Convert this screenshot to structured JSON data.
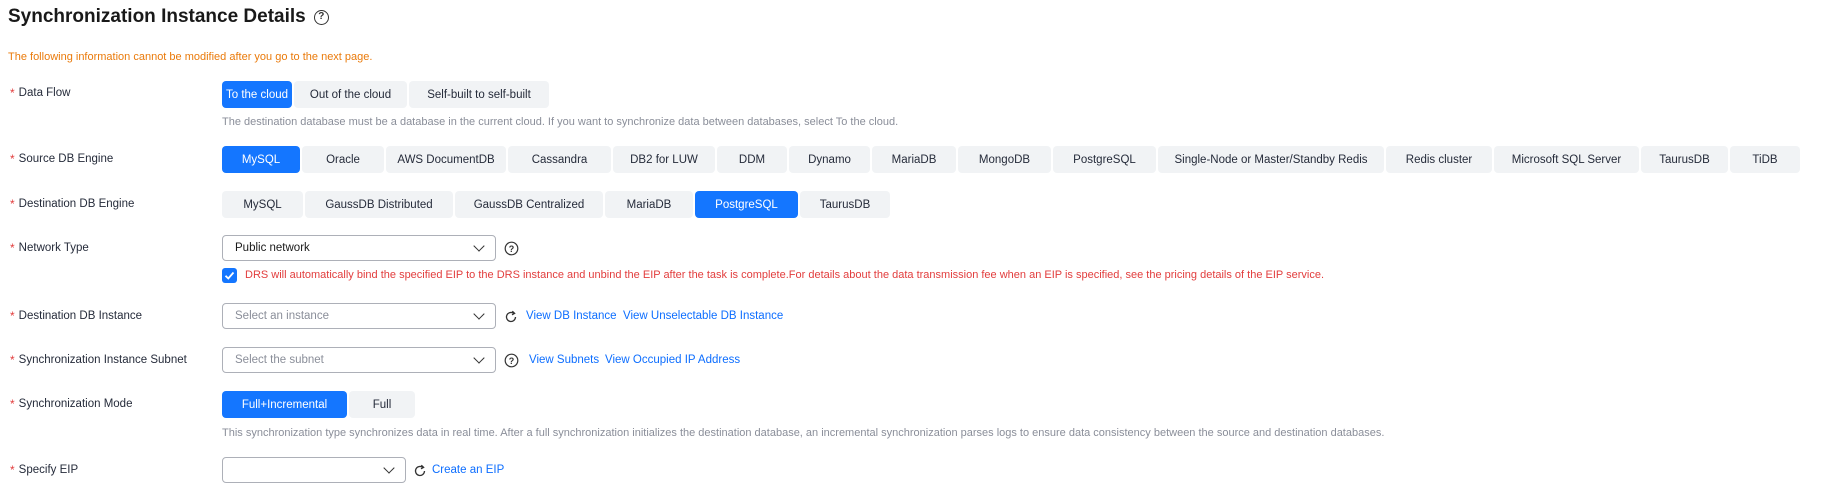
{
  "title": "Synchronization Instance Details",
  "warning": "The following information cannot be modified after you go to the next page.",
  "data_flow": {
    "label": "Data Flow",
    "options": [
      "To the cloud",
      "Out of the cloud",
      "Self-built to self-built"
    ],
    "selected": "To the cloud",
    "hint": "The destination database must be a database in the current cloud. If you want to synchronize data between databases, select To the cloud."
  },
  "source_engine": {
    "label": "Source DB Engine",
    "options": [
      "MySQL",
      "Oracle",
      "AWS DocumentDB",
      "Cassandra",
      "DB2 for LUW",
      "DDM",
      "Dynamo",
      "MariaDB",
      "MongoDB",
      "PostgreSQL",
      "Single-Node or Master/Standby Redis",
      "Redis cluster",
      "Microsoft SQL Server",
      "TaurusDB",
      "TiDB"
    ],
    "selected": "MySQL"
  },
  "dest_engine": {
    "label": "Destination DB Engine",
    "options": [
      "MySQL",
      "GaussDB Distributed",
      "GaussDB Centralized",
      "MariaDB",
      "PostgreSQL",
      "TaurusDB"
    ],
    "selected": "PostgreSQL"
  },
  "network_type": {
    "label": "Network Type",
    "value": "Public network",
    "checkbox_checked": true,
    "checkbox_text": "DRS will automatically bind the specified EIP to the DRS instance and unbind the EIP after the task is complete.For details about the data transmission fee when an EIP is specified, see the pricing details of the EIP service."
  },
  "dest_instance": {
    "label": "Destination DB Instance",
    "placeholder": "Select an instance",
    "link1": "View DB Instance",
    "link2": "View Unselectable DB Instance"
  },
  "subnet": {
    "label": "Synchronization Instance Subnet",
    "placeholder": "Select the subnet",
    "link1": "View Subnets",
    "link2": "View Occupied IP Address"
  },
  "sync_mode": {
    "label": "Synchronization Mode",
    "options": [
      "Full+Incremental",
      "Full"
    ],
    "selected": "Full+Incremental",
    "hint": "This synchronization type synchronizes data in real time. After a full synchronization initializes the destination database, an incremental synchronization parses logs to ensure data consistency between the source and destination databases."
  },
  "eip": {
    "label": "Specify EIP",
    "value": "",
    "link": "Create an EIP"
  },
  "colors": {
    "accent": "#1476ff",
    "warning": "#ea7a0a",
    "error": "#e23d3d",
    "link": "#0d6eff"
  }
}
